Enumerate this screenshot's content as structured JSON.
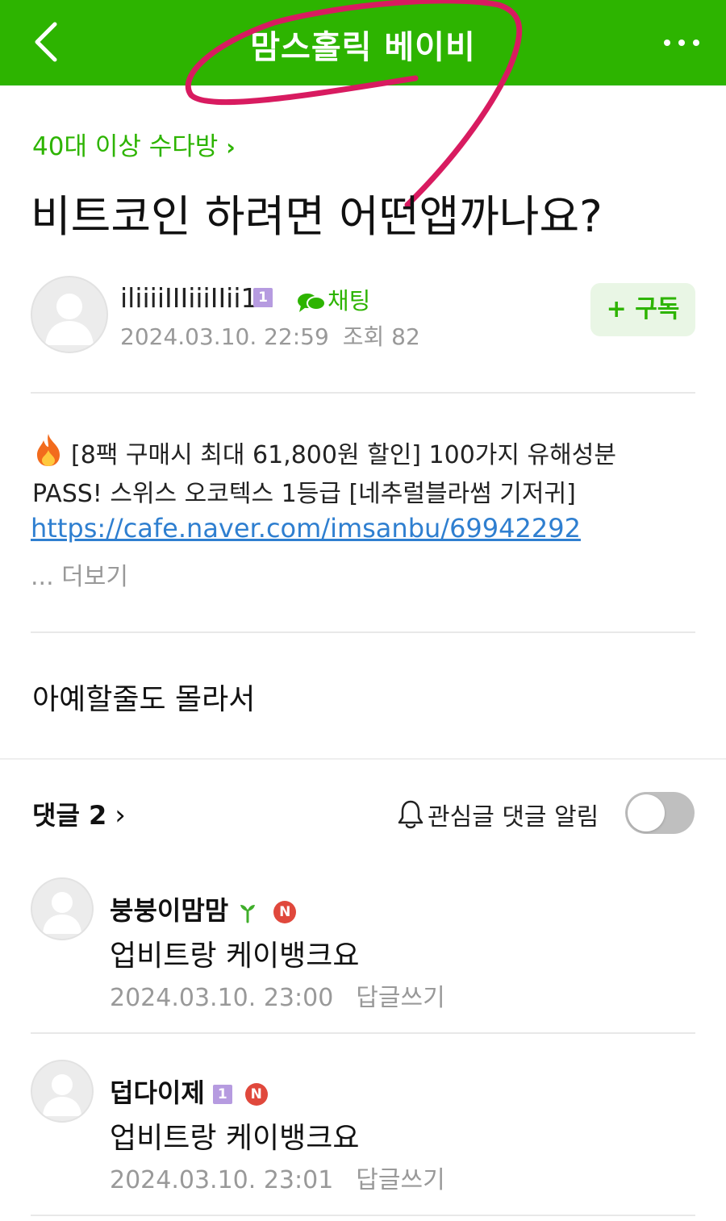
{
  "header": {
    "title": "맘스홀릭 베이비",
    "background_color": "#2db400",
    "back_icon": "chevron-left-icon",
    "more_icon": "more-dots-icon"
  },
  "annotation": {
    "color": "#d81b60"
  },
  "post": {
    "board_link": "40대 이상 수다방",
    "title": "비트코인 하려면 어떤앱까나요?",
    "author": {
      "name": "iliiiiIIIiiiIIii11",
      "level": "1",
      "chat_label": "채팅"
    },
    "date": "2024.03.10. 22:59",
    "views_label": "조회",
    "views": "82",
    "subscribe_label": "+ 구독",
    "ad": {
      "text": "[8팩 구매시 최대 61,800원 할인] 100가지 유해성분 PASS! 스위스 오코텍스 1등급 [네추럴블라썸 기저귀]",
      "link": "https://cafe.naver.com/imsanbu/69942292",
      "more_label": "... 더보기"
    },
    "body": "아예할줄도 몰라서"
  },
  "comments_section": {
    "title": "댓글 2",
    "notify_label": "관심글 댓글 알림",
    "notify_on": false,
    "comments": [
      {
        "author": "붕붕이맘맘",
        "badge": "N",
        "text": "업비트랑 케이뱅크요",
        "date": "2024.03.10. 23:00",
        "reply_label": "답글쓰기"
      },
      {
        "author": "덥다이제",
        "level": "1",
        "badge": "N",
        "text": "업비트랑 케이뱅크요",
        "date": "2024.03.10. 23:01",
        "reply_label": "답글쓰기"
      }
    ]
  }
}
